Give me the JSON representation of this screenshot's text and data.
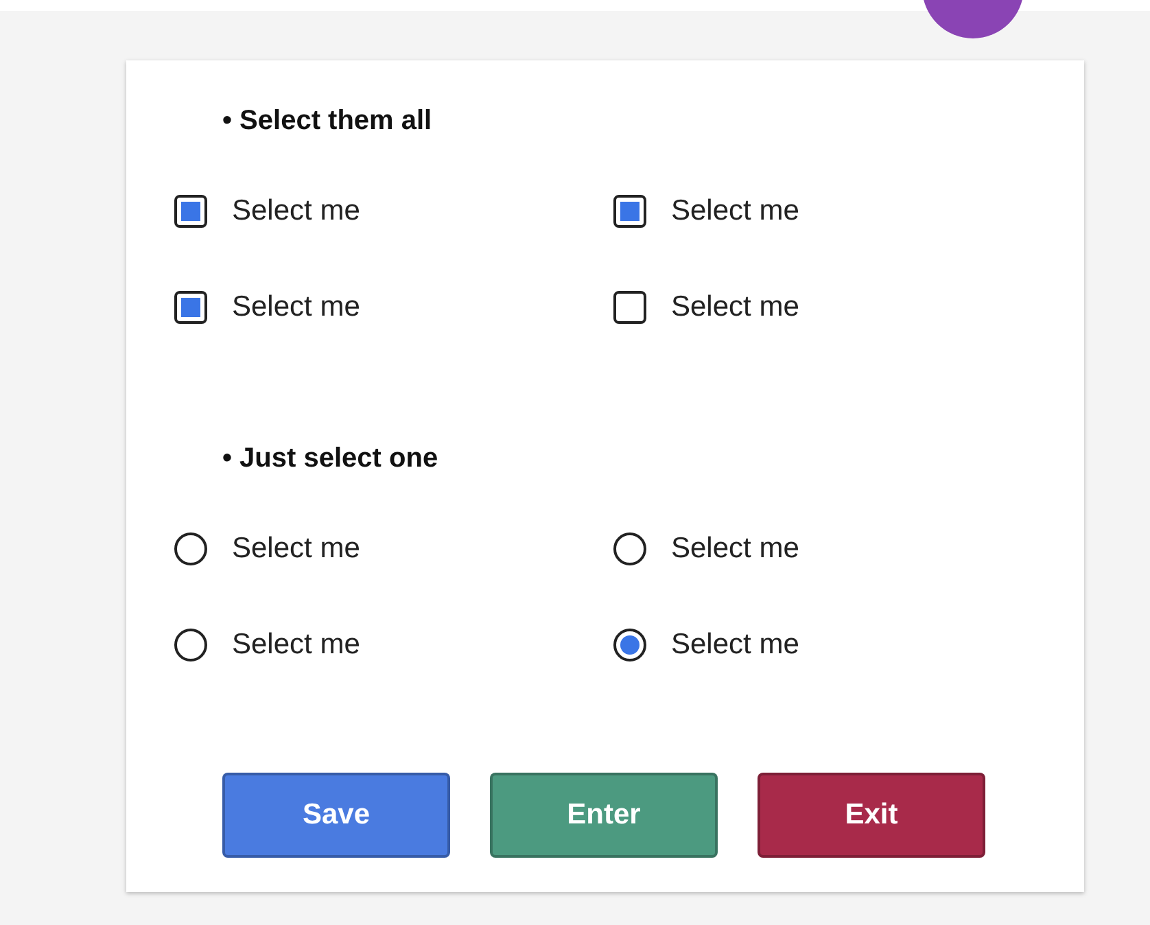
{
  "sections": [
    {
      "heading": "• Select them all",
      "kind": "checkbox",
      "options": [
        {
          "label": "Select me",
          "checked": true
        },
        {
          "label": "Select me",
          "checked": true
        },
        {
          "label": "Select me",
          "checked": true
        },
        {
          "label": "Select me",
          "checked": false
        }
      ]
    },
    {
      "heading": "• Just select one",
      "kind": "radio",
      "options": [
        {
          "label": "Select me",
          "selected": false
        },
        {
          "label": "Select me",
          "selected": false
        },
        {
          "label": "Select me",
          "selected": false
        },
        {
          "label": "Select me",
          "selected": true
        }
      ]
    }
  ],
  "buttons": [
    {
      "label": "Save",
      "color": "#4a7be0"
    },
    {
      "label": "Enter",
      "color": "#4c9a80"
    },
    {
      "label": "Exit",
      "color": "#a82a4a"
    }
  ]
}
